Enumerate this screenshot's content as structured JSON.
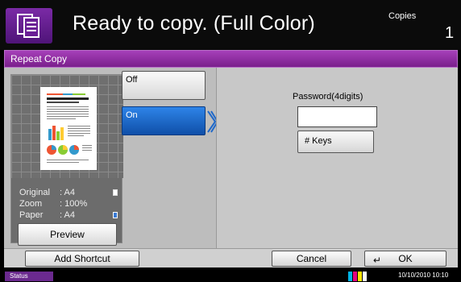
{
  "header": {
    "status": "Ready to copy. (Full Color)",
    "copies_label": "Copies",
    "copies_count": "1"
  },
  "screen": {
    "title": "Repeat Copy"
  },
  "preview": {
    "original_label": "Original",
    "original_value": ": A4",
    "zoom_label": "Zoom",
    "zoom_value": ": 100%",
    "paper_label": "Paper",
    "paper_value": ": A4",
    "button": "Preview"
  },
  "options": {
    "off": "Off",
    "on": "On",
    "selected": "On"
  },
  "password": {
    "label": "Password(4digits)",
    "value": "",
    "keys_button": "# Keys"
  },
  "footer": {
    "add_shortcut": "Add Shortcut",
    "cancel": "Cancel",
    "ok": "OK"
  },
  "status_bar": {
    "status": "Status",
    "datetime": "10/10/2010  10:10"
  },
  "colors": {
    "accent": "#7a1f8c",
    "selected": "#1f68c9"
  },
  "icons": [
    "copy-icon",
    "chevron-right-icon",
    "paper-icon",
    "enter-icon",
    "toner-icon"
  ]
}
